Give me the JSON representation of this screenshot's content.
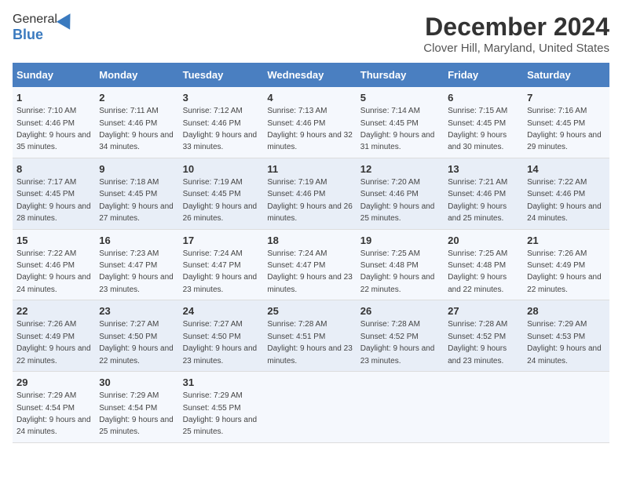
{
  "logo": {
    "general": "General",
    "blue": "Blue"
  },
  "title": "December 2024",
  "subtitle": "Clover Hill, Maryland, United States",
  "days_of_week": [
    "Sunday",
    "Monday",
    "Tuesday",
    "Wednesday",
    "Thursday",
    "Friday",
    "Saturday"
  ],
  "weeks": [
    [
      {
        "num": "1",
        "sunrise": "7:10 AM",
        "sunset": "4:46 PM",
        "daylight": "9 hours and 35 minutes."
      },
      {
        "num": "2",
        "sunrise": "7:11 AM",
        "sunset": "4:46 PM",
        "daylight": "9 hours and 34 minutes."
      },
      {
        "num": "3",
        "sunrise": "7:12 AM",
        "sunset": "4:46 PM",
        "daylight": "9 hours and 33 minutes."
      },
      {
        "num": "4",
        "sunrise": "7:13 AM",
        "sunset": "4:46 PM",
        "daylight": "9 hours and 32 minutes."
      },
      {
        "num": "5",
        "sunrise": "7:14 AM",
        "sunset": "4:45 PM",
        "daylight": "9 hours and 31 minutes."
      },
      {
        "num": "6",
        "sunrise": "7:15 AM",
        "sunset": "4:45 PM",
        "daylight": "9 hours and 30 minutes."
      },
      {
        "num": "7",
        "sunrise": "7:16 AM",
        "sunset": "4:45 PM",
        "daylight": "9 hours and 29 minutes."
      }
    ],
    [
      {
        "num": "8",
        "sunrise": "7:17 AM",
        "sunset": "4:45 PM",
        "daylight": "9 hours and 28 minutes."
      },
      {
        "num": "9",
        "sunrise": "7:18 AM",
        "sunset": "4:45 PM",
        "daylight": "9 hours and 27 minutes."
      },
      {
        "num": "10",
        "sunrise": "7:19 AM",
        "sunset": "4:45 PM",
        "daylight": "9 hours and 26 minutes."
      },
      {
        "num": "11",
        "sunrise": "7:19 AM",
        "sunset": "4:46 PM",
        "daylight": "9 hours and 26 minutes."
      },
      {
        "num": "12",
        "sunrise": "7:20 AM",
        "sunset": "4:46 PM",
        "daylight": "9 hours and 25 minutes."
      },
      {
        "num": "13",
        "sunrise": "7:21 AM",
        "sunset": "4:46 PM",
        "daylight": "9 hours and 25 minutes."
      },
      {
        "num": "14",
        "sunrise": "7:22 AM",
        "sunset": "4:46 PM",
        "daylight": "9 hours and 24 minutes."
      }
    ],
    [
      {
        "num": "15",
        "sunrise": "7:22 AM",
        "sunset": "4:46 PM",
        "daylight": "9 hours and 24 minutes."
      },
      {
        "num": "16",
        "sunrise": "7:23 AM",
        "sunset": "4:47 PM",
        "daylight": "9 hours and 23 minutes."
      },
      {
        "num": "17",
        "sunrise": "7:24 AM",
        "sunset": "4:47 PM",
        "daylight": "9 hours and 23 minutes."
      },
      {
        "num": "18",
        "sunrise": "7:24 AM",
        "sunset": "4:47 PM",
        "daylight": "9 hours and 23 minutes."
      },
      {
        "num": "19",
        "sunrise": "7:25 AM",
        "sunset": "4:48 PM",
        "daylight": "9 hours and 22 minutes."
      },
      {
        "num": "20",
        "sunrise": "7:25 AM",
        "sunset": "4:48 PM",
        "daylight": "9 hours and 22 minutes."
      },
      {
        "num": "21",
        "sunrise": "7:26 AM",
        "sunset": "4:49 PM",
        "daylight": "9 hours and 22 minutes."
      }
    ],
    [
      {
        "num": "22",
        "sunrise": "7:26 AM",
        "sunset": "4:49 PM",
        "daylight": "9 hours and 22 minutes."
      },
      {
        "num": "23",
        "sunrise": "7:27 AM",
        "sunset": "4:50 PM",
        "daylight": "9 hours and 22 minutes."
      },
      {
        "num": "24",
        "sunrise": "7:27 AM",
        "sunset": "4:50 PM",
        "daylight": "9 hours and 23 minutes."
      },
      {
        "num": "25",
        "sunrise": "7:28 AM",
        "sunset": "4:51 PM",
        "daylight": "9 hours and 23 minutes."
      },
      {
        "num": "26",
        "sunrise": "7:28 AM",
        "sunset": "4:52 PM",
        "daylight": "9 hours and 23 minutes."
      },
      {
        "num": "27",
        "sunrise": "7:28 AM",
        "sunset": "4:52 PM",
        "daylight": "9 hours and 23 minutes."
      },
      {
        "num": "28",
        "sunrise": "7:29 AM",
        "sunset": "4:53 PM",
        "daylight": "9 hours and 24 minutes."
      }
    ],
    [
      {
        "num": "29",
        "sunrise": "7:29 AM",
        "sunset": "4:54 PM",
        "daylight": "9 hours and 24 minutes."
      },
      {
        "num": "30",
        "sunrise": "7:29 AM",
        "sunset": "4:54 PM",
        "daylight": "9 hours and 25 minutes."
      },
      {
        "num": "31",
        "sunrise": "7:29 AM",
        "sunset": "4:55 PM",
        "daylight": "9 hours and 25 minutes."
      },
      null,
      null,
      null,
      null
    ]
  ]
}
